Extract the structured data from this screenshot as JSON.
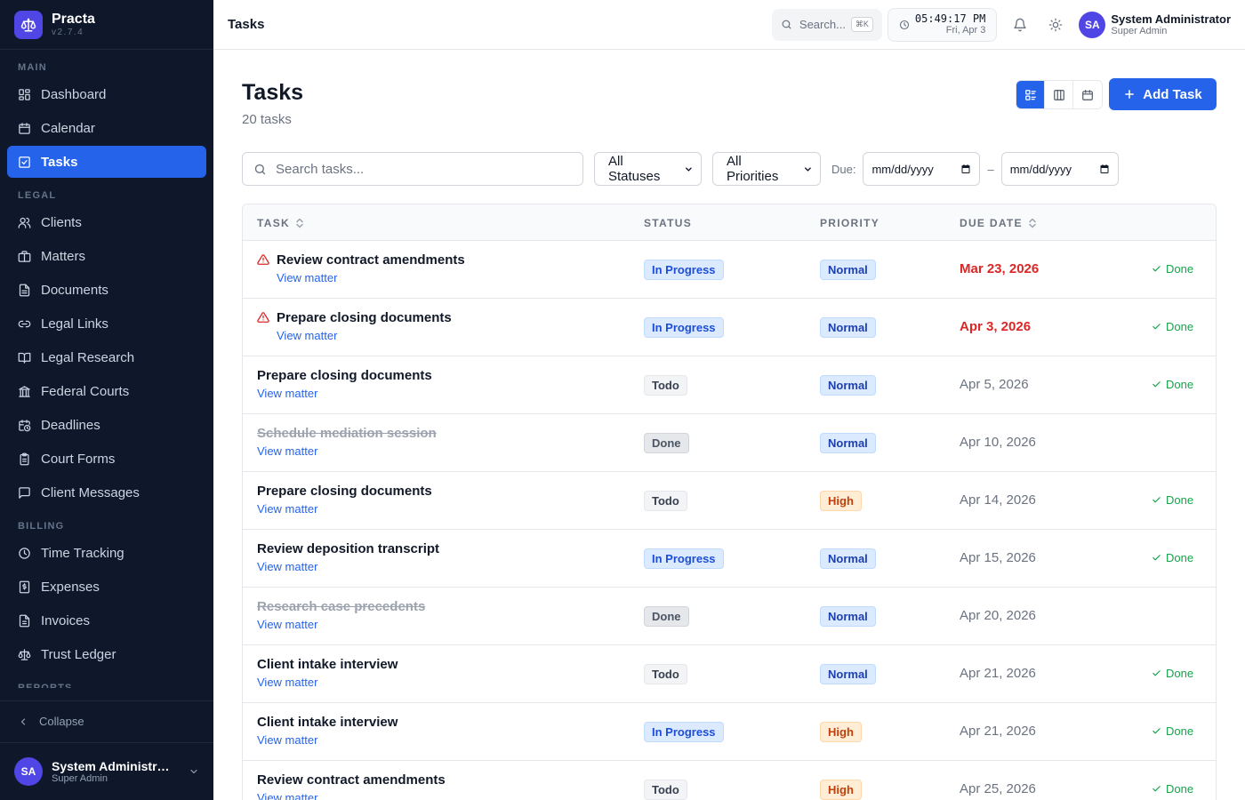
{
  "brand": {
    "name": "Practa",
    "version": "v2.7.4"
  },
  "sidebar": {
    "sections": [
      {
        "title": "MAIN",
        "items": [
          {
            "label": "Dashboard",
            "icon": "dashboard-icon",
            "active": false
          },
          {
            "label": "Calendar",
            "icon": "calendar-icon",
            "active": false
          },
          {
            "label": "Tasks",
            "icon": "tasks-icon",
            "active": true
          }
        ]
      },
      {
        "title": "LEGAL",
        "items": [
          {
            "label": "Clients",
            "icon": "users-icon",
            "active": false
          },
          {
            "label": "Matters",
            "icon": "briefcase-icon",
            "active": false
          },
          {
            "label": "Documents",
            "icon": "document-icon",
            "active": false
          },
          {
            "label": "Legal Links",
            "icon": "link-icon",
            "active": false
          },
          {
            "label": "Legal Research",
            "icon": "book-icon",
            "active": false
          },
          {
            "label": "Federal Courts",
            "icon": "landmark-icon",
            "active": false
          },
          {
            "label": "Deadlines",
            "icon": "calendar-clock-icon",
            "active": false
          },
          {
            "label": "Court Forms",
            "icon": "clipboard-icon",
            "active": false
          },
          {
            "label": "Client Messages",
            "icon": "message-icon",
            "active": false
          }
        ]
      },
      {
        "title": "BILLING",
        "items": [
          {
            "label": "Time Tracking",
            "icon": "clock-icon",
            "active": false
          },
          {
            "label": "Expenses",
            "icon": "receipt-icon",
            "active": false
          },
          {
            "label": "Invoices",
            "icon": "invoice-icon",
            "active": false
          },
          {
            "label": "Trust Ledger",
            "icon": "scale-icon",
            "active": false
          }
        ]
      },
      {
        "title": "REPORTS",
        "items": []
      }
    ],
    "collapse_label": "Collapse",
    "user": {
      "initials": "SA",
      "name": "System Administrator",
      "role": "Super Admin"
    }
  },
  "topbar": {
    "title": "Tasks",
    "search_placeholder": "Search...",
    "shortcut": "⌘K",
    "clock_time": "05:49:17 PM",
    "clock_date": "Fri, Apr 3",
    "user": {
      "initials": "SA",
      "name": "System Administrator",
      "role": "Super Admin"
    }
  },
  "page": {
    "title": "Tasks",
    "count_label": "20 tasks",
    "add_button": "Add Task"
  },
  "filters": {
    "search_placeholder": "Search tasks...",
    "status_value": "All Statuses",
    "priority_value": "All Priorities",
    "due_label": "Due:",
    "date_from_placeholder": "mm/dd/yyyy",
    "date_separator": "–",
    "date_to_placeholder": "mm/dd/yyyy"
  },
  "table": {
    "headers": {
      "task": "TASK",
      "status": "STATUS",
      "priority": "PRIORITY",
      "due": "DUE DATE"
    },
    "rows": [
      {
        "task": "Review contract amendments",
        "link": "View matter",
        "status": "In Progress",
        "priority": "Normal",
        "due": "Mar 23, 2026",
        "overdue": true,
        "completed": false,
        "action": "Done"
      },
      {
        "task": "Prepare closing documents",
        "link": "View matter",
        "status": "In Progress",
        "priority": "Normal",
        "due": "Apr 3, 2026",
        "overdue": true,
        "completed": false,
        "action": "Done"
      },
      {
        "task": "Prepare closing documents",
        "link": "View matter",
        "status": "Todo",
        "priority": "Normal",
        "due": "Apr 5, 2026",
        "overdue": false,
        "completed": false,
        "action": "Done"
      },
      {
        "task": "Schedule mediation session",
        "link": "View matter",
        "status": "Done",
        "priority": "Normal",
        "due": "Apr 10, 2026",
        "overdue": false,
        "completed": true,
        "action": ""
      },
      {
        "task": "Prepare closing documents",
        "link": "View matter",
        "status": "Todo",
        "priority": "High",
        "due": "Apr 14, 2026",
        "overdue": false,
        "completed": false,
        "action": "Done"
      },
      {
        "task": "Review deposition transcript",
        "link": "View matter",
        "status": "In Progress",
        "priority": "Normal",
        "due": "Apr 15, 2026",
        "overdue": false,
        "completed": false,
        "action": "Done"
      },
      {
        "task": "Research case precedents",
        "link": "View matter",
        "status": "Done",
        "priority": "Normal",
        "due": "Apr 20, 2026",
        "overdue": false,
        "completed": true,
        "action": ""
      },
      {
        "task": "Client intake interview",
        "link": "View matter",
        "status": "Todo",
        "priority": "Normal",
        "due": "Apr 21, 2026",
        "overdue": false,
        "completed": false,
        "action": "Done"
      },
      {
        "task": "Client intake interview",
        "link": "View matter",
        "status": "In Progress",
        "priority": "High",
        "due": "Apr 21, 2026",
        "overdue": false,
        "completed": false,
        "action": "Done"
      },
      {
        "task": "Review contract amendments",
        "link": "View matter",
        "status": "Todo",
        "priority": "High",
        "due": "Apr 25, 2026",
        "overdue": false,
        "completed": false,
        "action": "Done"
      }
    ]
  },
  "colors": {
    "sidebar_bg": "#0f172a",
    "accent": "#2563eb",
    "overdue": "#dc2626",
    "done_action": "#16a34a"
  }
}
